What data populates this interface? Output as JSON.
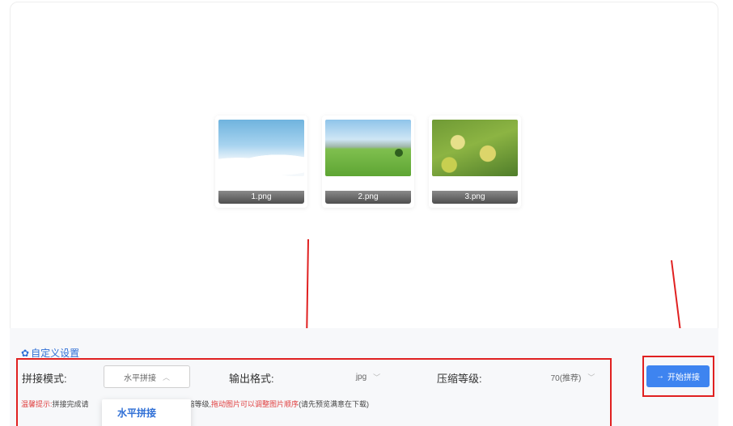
{
  "images": [
    {
      "name": "1.png"
    },
    {
      "name": "2.png"
    },
    {
      "name": "3.png"
    }
  ],
  "settings": {
    "title": "自定义设置",
    "stitch_mode": {
      "label": "拼接模式:",
      "value": "水平拼接"
    },
    "output_format": {
      "label": "输出格式:",
      "value": "jpg"
    },
    "compression": {
      "label": "压缩等级:",
      "value": "70(推荐)"
    }
  },
  "hint": {
    "prefix": "温馨提示:",
    "text1": "拼接完成请",
    "text2": "整压缩等级,",
    "highlight": "拖动图片可以调整图片顺序",
    "text3": "(请先预览满意在下载)"
  },
  "dropdown": {
    "option": "水平拼接"
  },
  "start_button": {
    "label": "开始拼接"
  },
  "colors": {
    "accent": "#3e84f0",
    "annotation": "#e02020",
    "link": "#2f6fd6"
  }
}
